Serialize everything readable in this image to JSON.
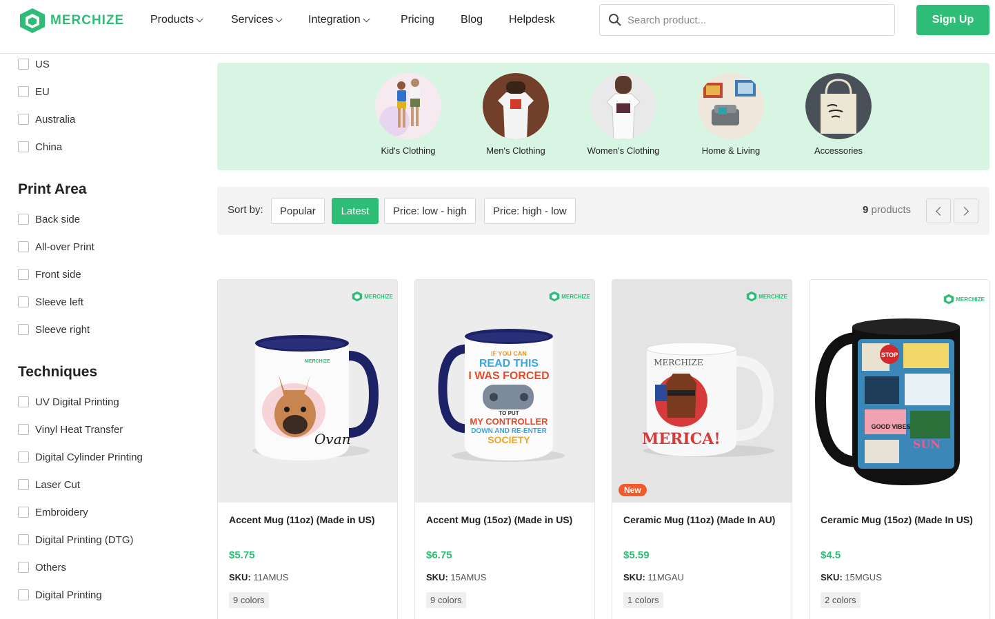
{
  "header": {
    "logo_text": "MERCHIZE",
    "nav": [
      {
        "label": "Products",
        "dropdown": true
      },
      {
        "label": "Services",
        "dropdown": true
      },
      {
        "label": "Integration",
        "dropdown": true
      },
      {
        "label": "Pricing",
        "dropdown": false
      },
      {
        "label": "Blog",
        "dropdown": false
      },
      {
        "label": "Helpdesk",
        "dropdown": false
      }
    ],
    "search_placeholder": "Search product...",
    "signup_label": "Sign Up"
  },
  "sidebar": {
    "location_options": [
      "US",
      "EU",
      "Australia",
      "China"
    ],
    "print_area": {
      "heading": "Print Area",
      "options": [
        "Back side",
        "All-over Print",
        "Front side",
        "Sleeve left",
        "Sleeve right"
      ]
    },
    "techniques": {
      "heading": "Techniques",
      "options": [
        "UV Digital Printing",
        "Vinyl Heat Transfer",
        "Digital Cylinder Printing",
        "Laser Cut",
        "Embroidery",
        "Digital Printing (DTG)",
        "Others",
        "Digital Printing"
      ]
    }
  },
  "categories": [
    {
      "label": "Kid's Clothing"
    },
    {
      "label": "Men's Clothing"
    },
    {
      "label": "Women's Clothing"
    },
    {
      "label": "Home & Living"
    },
    {
      "label": "Accessories"
    }
  ],
  "sort": {
    "label": "Sort by:",
    "options": [
      "Popular",
      "Latest",
      "Price: low - high",
      "Price: high - low"
    ],
    "active": "Latest",
    "count_number": "9",
    "count_suffix": "products"
  },
  "products": [
    {
      "title": "Accent Mug (11oz) (Made in US)",
      "price": "$5.75",
      "sku_label": "SKU:",
      "sku": "11AMUS",
      "colors": "9 colors",
      "badge": ""
    },
    {
      "title": "Accent Mug (15oz) (Made in US)",
      "price": "$6.75",
      "sku_label": "SKU:",
      "sku": "15AMUS",
      "colors": "9 colors",
      "badge": ""
    },
    {
      "title": "Ceramic Mug (11oz) (Made In AU)",
      "price": "$5.59",
      "sku_label": "SKU:",
      "sku": "11MGAU",
      "colors": "1 colors",
      "badge": "New"
    },
    {
      "title": "Ceramic Mug (15oz) (Made In US)",
      "price": "$4.5",
      "sku_label": "SKU:",
      "sku": "15MGUS",
      "colors": "2 colors",
      "badge": ""
    }
  ],
  "mug_print_text": {
    "p1": [
      "Ovan"
    ],
    "p2": [
      "IF YOU CAN",
      "READ THIS",
      "I WAS FORCED",
      "TO PUT",
      "MY CONTROLLER",
      "DOWN AND RE-ENTER",
      "SOCIETY"
    ],
    "p3": [
      "MERCHIZE",
      "MERICA!"
    ],
    "p4": [
      "STOP",
      "GOOD VIBES",
      "SUN"
    ]
  },
  "colors": {
    "brand_green": "#2dbd76",
    "banner_bg": "#d8f4e3",
    "new_badge": "#f25a2b"
  }
}
